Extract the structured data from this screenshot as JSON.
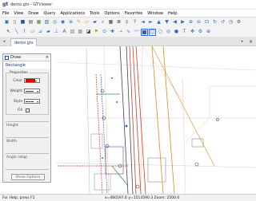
{
  "window": {
    "title": "demo.gts - GTViewer",
    "logo": "gt"
  },
  "menu": [
    "File",
    "View",
    "Draw",
    "Query",
    "Applications",
    "Tools",
    "Options",
    "Favorites",
    "Window",
    "Help"
  ],
  "toolbar_row1": [
    {
      "name": "open-icon",
      "glyph": "▣",
      "color": "#2f6db6"
    },
    {
      "name": "document-icon",
      "glyph": "▯",
      "color": "#666"
    },
    {
      "name": "save-icon",
      "glyph": "■",
      "color": "#1e56a8"
    },
    {
      "name": "print-icon",
      "glyph": "▤",
      "color": "#555"
    },
    {
      "name": "map-icon",
      "glyph": "▦",
      "color": "#3c8c3c"
    },
    {
      "name": "layers-icon",
      "glyph": "▧",
      "color": "#3a76c6"
    },
    {
      "name": "zoom-icon",
      "glyph": "◎",
      "color": "#246fd0"
    },
    {
      "name": "pan-icon",
      "glyph": "◉",
      "color": "#2563c7"
    },
    {
      "name": "globe-icon",
      "glyph": "⊕",
      "color": "#2a7ab0"
    },
    {
      "name": "pencil-icon",
      "glyph": "✎",
      "color": "#d4a000"
    },
    {
      "name": "eraser-icon",
      "glyph": "▱",
      "color": "#d38b14"
    },
    {
      "name": "bookmark-icon",
      "glyph": "▰",
      "color": "#2563c7"
    },
    {
      "name": "search-icon",
      "glyph": "⌕",
      "color": "#2f6db6"
    },
    {
      "name": "grid-icon",
      "glyph": "▦",
      "color": "#444"
    },
    {
      "name": "list-icon",
      "glyph": "≣",
      "color": "#333"
    },
    {
      "name": "highlight-icon",
      "glyph": "▮",
      "color": "#b0b0b0"
    },
    {
      "name": "help-icon",
      "glyph": "?",
      "color": "#1e56a8"
    },
    {
      "name": "back-icon",
      "glyph": "◄",
      "color": "#2b6cd2"
    },
    {
      "name": "forward-icon",
      "glyph": "►",
      "color": "#2b6cd2"
    },
    {
      "name": "up-icon",
      "glyph": "▲",
      "color": "#2b6cd2"
    },
    {
      "name": "down-icon",
      "glyph": "▼",
      "color": "#2b6cd2"
    },
    {
      "name": "prev-view-icon",
      "glyph": "◀",
      "color": "#2b6cd2"
    },
    {
      "name": "next-view-icon",
      "glyph": "▶",
      "color": "#2b6cd2"
    },
    {
      "name": "zoom-in-icon",
      "glyph": "⊕",
      "color": "#2b6cd2"
    },
    {
      "name": "zoom-out-icon",
      "glyph": "⊖",
      "color": "#2b6cd2"
    },
    {
      "name": "fit-icon",
      "glyph": "⊡",
      "color": "#2b6cd2"
    },
    {
      "name": "rotate-icon",
      "glyph": "↻",
      "color": "#2b6cd2"
    },
    {
      "name": "refresh-icon",
      "glyph": "↺",
      "color": "#2b6cd2"
    },
    {
      "name": "clock-icon",
      "glyph": "◷",
      "color": "#555"
    },
    {
      "name": "settings-icon",
      "glyph": "⚙",
      "color": "#555"
    }
  ],
  "toolbar_row2": [
    {
      "name": "select-icon",
      "glyph": "↖",
      "color": "#333"
    },
    {
      "name": "line-icon",
      "glyph": "╲",
      "color": "#2b6cd2"
    },
    {
      "name": "polyline-icon",
      "glyph": "⌇",
      "color": "#2b6cd2"
    },
    {
      "name": "eraser2-icon",
      "glyph": "▱",
      "color": "#d1446e"
    },
    {
      "name": "measure-icon",
      "glyph": "⊿",
      "color": "#2b6cd2"
    },
    {
      "name": "area-icon",
      "glyph": "▰",
      "color": "#2b6cd2"
    },
    {
      "name": "dimension-icon",
      "glyph": "⊥",
      "color": "#2b6cd2"
    },
    {
      "name": "text-icon",
      "glyph": "A",
      "color": "#2b6cd2"
    },
    {
      "name": "hatch-icon",
      "glyph": "▨",
      "color": "#888"
    },
    {
      "name": "fill-icon",
      "glyph": "▩",
      "color": "#888"
    },
    {
      "name": "bucket-icon",
      "glyph": "◪",
      "color": "#333"
    },
    {
      "name": "flag-icon",
      "glyph": "⚑",
      "color": "#c9a000"
    },
    {
      "name": "pin-icon",
      "glyph": "⊙",
      "color": "#2b6cd2"
    },
    {
      "name": "cross-icon",
      "glyph": "✚",
      "color": "#2b6cd2"
    },
    {
      "name": "arrow-icon",
      "glyph": "➝",
      "color": "#2b6cd2"
    },
    {
      "name": "curve-icon",
      "glyph": "∿",
      "color": "#2b6cd2"
    },
    {
      "name": "freehand-icon",
      "glyph": "〰",
      "color": "#2b6cd2"
    },
    {
      "name": "rectangle-icon",
      "glyph": "▭",
      "color": "#2b6cd2",
      "state": "active"
    },
    {
      "name": "rectangle-outline-icon",
      "glyph": "□",
      "color": "#2b6cd2",
      "state": "selected"
    },
    {
      "name": "circle-icon",
      "glyph": "○",
      "color": "#2b6cd2"
    },
    {
      "name": "target-icon",
      "glyph": "◎",
      "color": "#2b6cd2"
    },
    {
      "name": "dot-icon",
      "glyph": "●",
      "color": "#2b6cd2"
    },
    {
      "name": "symbol-text-icon",
      "glyph": "T",
      "color": "#2b6cd2"
    },
    {
      "name": "anchor-icon",
      "glyph": "✥",
      "color": "#2b6cd2"
    },
    {
      "name": "settings2-icon",
      "glyph": "⚙",
      "color": "#2b6cd2"
    },
    {
      "name": "crosshair-icon",
      "glyph": "⊕",
      "color": "#2b6cd2"
    }
  ],
  "tabs": {
    "doc": "demo.gts",
    "prev": "◂",
    "next": "▸",
    "close": "×"
  },
  "draw_panel": {
    "title": "Draw",
    "close": "×",
    "shape": "Rectangle",
    "group_title": "Properties",
    "color_label": "Color",
    "weight_label": "Weight",
    "style_label": "Style",
    "fill_label": "Fill",
    "height_label": "Height",
    "width_label": "Width",
    "angle_label": "Angle (deg)",
    "show_options": "Show Options",
    "color_value": "#e00000"
  },
  "status": {
    "help": "For Help, press F1",
    "coords": "x=460197.6 y=1513590.3  Zoom: 2500.0"
  }
}
